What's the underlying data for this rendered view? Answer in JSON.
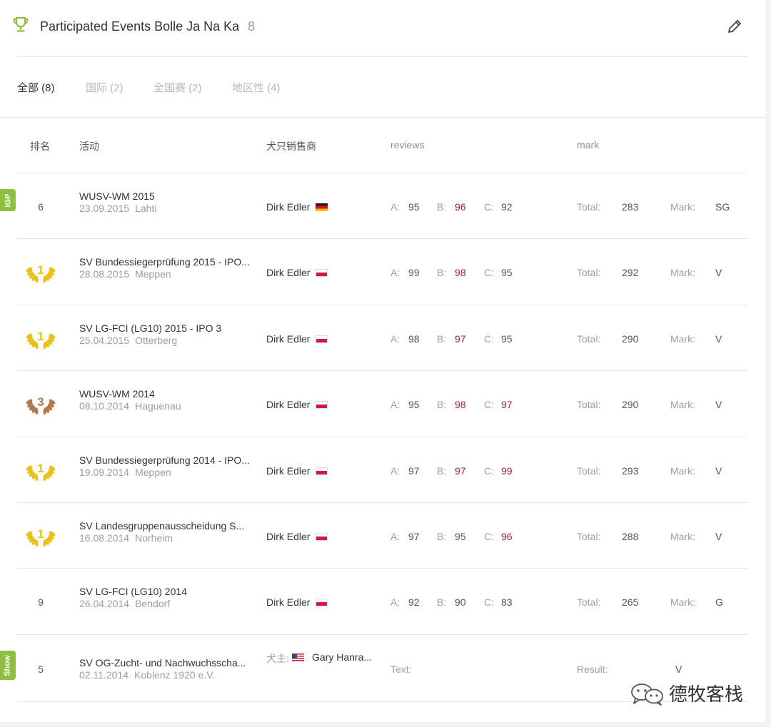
{
  "header": {
    "title": "Participated Events Bolle Ja Na Ka",
    "count": "8"
  },
  "tabs": [
    {
      "label": "全部 (8)",
      "active": true
    },
    {
      "label": "国际 (2)",
      "active": false
    },
    {
      "label": "全国赛 (2)",
      "active": false
    },
    {
      "label": "地区性 (4)",
      "active": false
    }
  ],
  "columns": {
    "rank": "排名",
    "event": "活动",
    "handler": "犬只销售商",
    "reviews": "reviews",
    "mark": "mark"
  },
  "labels": {
    "a": "A:",
    "b": "B:",
    "c": "C:",
    "total": "Total:",
    "mark": "Mark:",
    "owner": "犬主:",
    "text": "Text:",
    "result": "Result:"
  },
  "side_tags": {
    "igp": "IGP",
    "show": "Show"
  },
  "rows": [
    {
      "rank": "6",
      "name": "WUSV-WM 2015",
      "date": "23.09.2015",
      "location": "Lahti",
      "handler": "Dirk Edler",
      "flag": "de",
      "a": "95",
      "b": "96",
      "c": "92",
      "total": "283",
      "mark": "SG"
    },
    {
      "rank": "1",
      "name": "SV Bundessiegerprüfung 2015 - IPO...",
      "date": "28.08.2015",
      "location": "Meppen",
      "handler": "Dirk Edler",
      "flag": "pl",
      "a": "99",
      "b": "98",
      "c": "95",
      "total": "292",
      "mark": "V"
    },
    {
      "rank": "1",
      "name": "SV LG-FCI (LG10) 2015 - IPO 3",
      "date": "25.04.2015",
      "location": "Otterberg",
      "handler": "Dirk Edler",
      "flag": "pl",
      "a": "98",
      "b": "97",
      "c": "95",
      "total": "290",
      "mark": "V"
    },
    {
      "rank": "3",
      "name": "WUSV-WM 2014",
      "date": "08.10.2014",
      "location": "Haguenau",
      "handler": "Dirk Edler",
      "flag": "pl",
      "a": "95",
      "b": "98",
      "c": "97",
      "total": "290",
      "mark": "V"
    },
    {
      "rank": "1",
      "name": "SV Bundessiegerprüfung 2014 - IPO...",
      "date": "19.09.2014",
      "location": "Meppen",
      "handler": "Dirk Edler",
      "flag": "pl",
      "a": "97",
      "b": "97",
      "c": "99",
      "total": "293",
      "mark": "V"
    },
    {
      "rank": "1",
      "name": "SV Landesgruppenausscheidung S...",
      "date": "16.08.2014",
      "location": "Norheim",
      "handler": "Dirk Edler",
      "flag": "pl",
      "a": "97",
      "b": "95",
      "c": "96",
      "total": "288",
      "mark": "V"
    },
    {
      "rank": "9",
      "name": "SV LG-FCI (LG10) 2014",
      "date": "26.04.2014",
      "location": "Bendorf",
      "handler": "Dirk Edler",
      "flag": "pl",
      "a": "92",
      "b": "90",
      "c": "83",
      "total": "265",
      "mark": "G"
    }
  ],
  "show_row": {
    "rank": "5",
    "name": "SV OG-Zucht- und Nachwuchsscha...",
    "date": "02.11.2014",
    "location": "Koblenz 1920 e.V.",
    "owner": "Gary Hanra...",
    "flag": "us",
    "result": "V"
  },
  "watermark": {
    "text": "德牧客栈"
  },
  "colors": {
    "accent_green": "#8dc03f",
    "score_red": "#a52430",
    "gold": "#e8c21a",
    "bronze": "#b07a4a"
  }
}
